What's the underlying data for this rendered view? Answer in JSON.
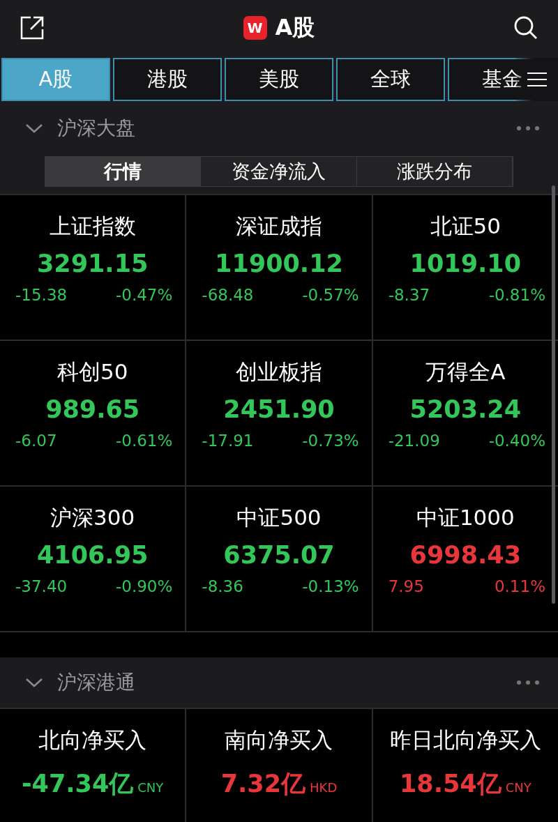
{
  "header": {
    "title": "A股",
    "logo": "W"
  },
  "tabs": [
    {
      "label": "A股",
      "selected": true
    },
    {
      "label": "港股",
      "selected": false
    },
    {
      "label": "美股",
      "selected": false
    },
    {
      "label": "全球",
      "selected": false
    },
    {
      "label": "基金",
      "selected": false
    }
  ],
  "sections": [
    {
      "title": "沪深大盘",
      "expanded": true,
      "segments": [
        {
          "label": "行情",
          "selected": true
        },
        {
          "label": "资金净流入",
          "selected": false
        },
        {
          "label": "涨跌分布",
          "selected": false
        }
      ],
      "cells": [
        {
          "kind": "index",
          "name": "上证指数",
          "value": "3291.15",
          "change": "-15.38",
          "percent": "-0.47%",
          "color": "#33c759"
        },
        {
          "kind": "index",
          "name": "深证成指",
          "value": "11900.12",
          "change": "-68.48",
          "percent": "-0.57%",
          "color": "#33c759"
        },
        {
          "kind": "index",
          "name": "北证50",
          "value": "1019.10",
          "change": "-8.37",
          "percent": "-0.81%",
          "color": "#33c759"
        },
        {
          "kind": "index",
          "name": "科创50",
          "value": "989.65",
          "change": "-6.07",
          "percent": "-0.61%",
          "color": "#33c759"
        },
        {
          "kind": "index",
          "name": "创业板指",
          "value": "2451.90",
          "change": "-17.91",
          "percent": "-0.73%",
          "color": "#33c759"
        },
        {
          "kind": "index",
          "name": "万得全A",
          "value": "5203.24",
          "change": "-21.09",
          "percent": "-0.40%",
          "color": "#33c759"
        },
        {
          "kind": "index",
          "name": "沪深300",
          "value": "4106.95",
          "change": "-37.40",
          "percent": "-0.90%",
          "color": "#33c759"
        },
        {
          "kind": "index",
          "name": "中证500",
          "value": "6375.07",
          "change": "-8.36",
          "percent": "-0.13%",
          "color": "#33c759"
        },
        {
          "kind": "index",
          "name": "中证1000",
          "value": "6998.43",
          "change": "7.95",
          "percent": "0.11%",
          "color": "#e8363b"
        }
      ]
    },
    {
      "title": "沪深港通",
      "expanded": true,
      "cells": [
        {
          "kind": "flow",
          "name": "北向净买入",
          "value": "-47.34亿",
          "unit": "CNY",
          "color": "#33c759"
        },
        {
          "kind": "flow",
          "name": "南向净买入",
          "value": "7.32亿",
          "unit": "HKD",
          "color": "#e8363b"
        },
        {
          "kind": "flow",
          "name": "昨日北向净买入",
          "value": "18.54亿",
          "unit": "CNY",
          "color": "#e8363b"
        }
      ]
    }
  ]
}
